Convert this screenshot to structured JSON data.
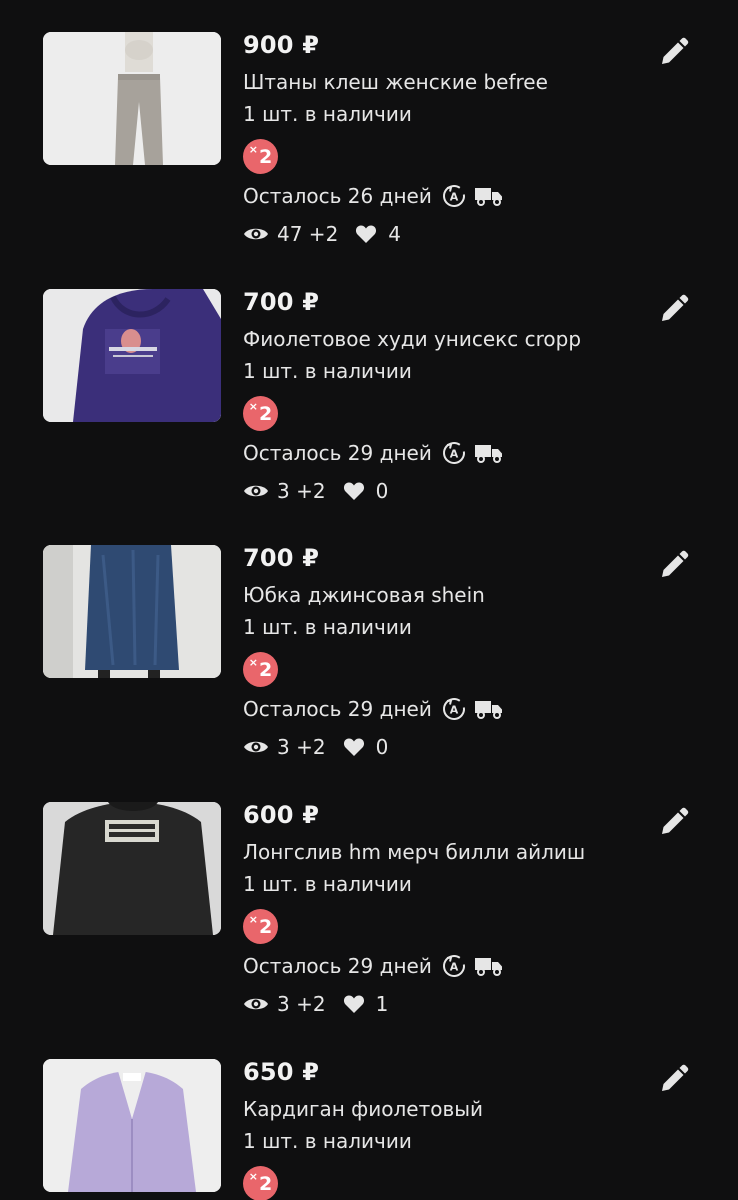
{
  "listings": [
    {
      "price": "900 ₽",
      "title": "Штаны клеш женские befree",
      "stock": "1 шт. в наличии",
      "boost_multiplier": "2",
      "days_left": "Осталось 26 дней",
      "views": "47 +2",
      "likes": "4",
      "thumb_icon": "pants-photo"
    },
    {
      "price": "700 ₽",
      "title": "Фиолетовое худи унисекс cropp",
      "stock": "1 шт. в наличии",
      "boost_multiplier": "2",
      "days_left": "Осталось 29 дней",
      "views": "3 +2",
      "likes": "0",
      "thumb_icon": "hoodie-photo"
    },
    {
      "price": "700 ₽",
      "title": "Юбка джинсовая shein",
      "stock": "1 шт. в наличии",
      "boost_multiplier": "2",
      "days_left": "Осталось 29 дней",
      "views": "3 +2",
      "likes": "0",
      "thumb_icon": "skirt-photo"
    },
    {
      "price": "600 ₽",
      "title": "Лонгслив hm мерч билли айлиш",
      "stock": "1 шт. в наличии",
      "boost_multiplier": "2",
      "days_left": "Осталось 29 дней",
      "views": "3 +2",
      "likes": "1",
      "thumb_icon": "longsleeve-photo"
    },
    {
      "price": "650 ₽",
      "title": "Кардиган фиолетовый",
      "stock": "1 шт. в наличии",
      "boost_multiplier": "2",
      "thumb_icon": "cardigan-photo"
    }
  ],
  "colors": {
    "background": "#0f0f10",
    "text": "#e6e6e6",
    "boost_badge": "#e9666b"
  },
  "icons": {
    "edit": "pencil-icon",
    "views": "eye-icon",
    "likes": "heart-icon",
    "auto_renew": "auto-renew-icon",
    "delivery": "truck-icon"
  }
}
